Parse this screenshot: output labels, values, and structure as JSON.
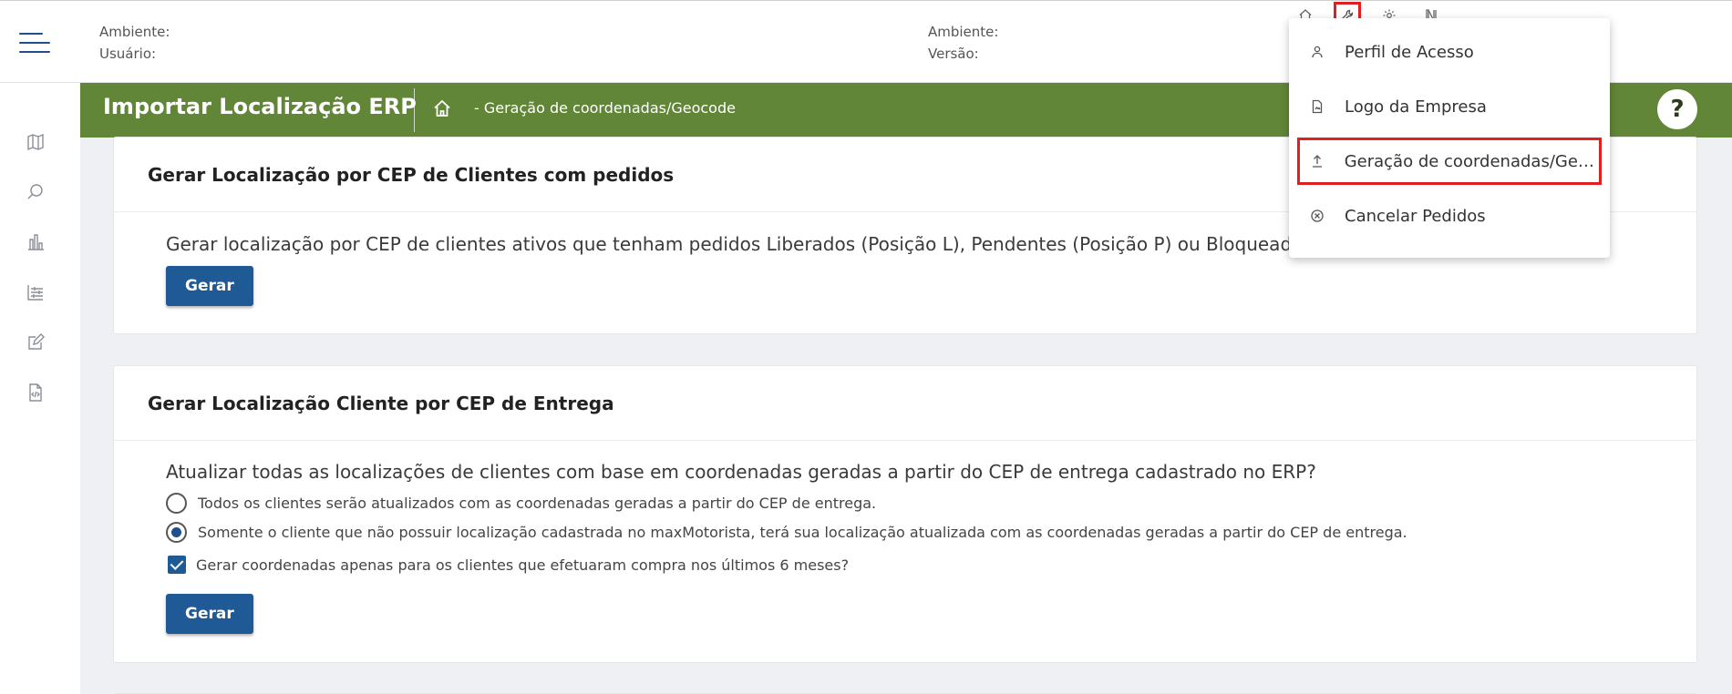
{
  "header": {
    "left": {
      "ambiente_label": "Ambiente:",
      "usuario_label": "Usuário:"
    },
    "right": {
      "ambiente_label": "Ambiente:",
      "versao_label": "Versão:"
    }
  },
  "top_icons": [
    "home-icon",
    "wrench-icon",
    "gear-icon",
    "map-book-icon"
  ],
  "rail_icons": [
    "map-icon",
    "search-icon",
    "bar-chart-icon",
    "sliders-icon",
    "edit-icon",
    "code-file-icon"
  ],
  "banner": {
    "title": "Importar Localização ERP",
    "breadcrumb": "- Geração de coordenadas/Geocode",
    "help": "?"
  },
  "menu": {
    "items": [
      {
        "label": "Perfil de Acesso",
        "icon": "user-icon"
      },
      {
        "label": "Logo da Empresa",
        "icon": "image-file-icon"
      },
      {
        "label": "Geração de coordenadas/Geo...",
        "icon": "upload-icon"
      },
      {
        "label": "Cancelar Pedidos",
        "icon": "cancel-circle-icon"
      }
    ]
  },
  "card1": {
    "title": "Gerar Localização por CEP de Clientes com pedidos",
    "question": "Gerar localização por CEP de clientes ativos que tenham pedidos Liberados (Posição L), Pendentes (Posição P) ou Bloqueados (Po",
    "button": "Gerar"
  },
  "card2": {
    "title": "Gerar Localização Cliente por CEP de Entrega",
    "question": "Atualizar todas as localizações de clientes com base em coordenadas geradas a partir do CEP de entrega cadastrado no ERP?",
    "option_all": "Todos os clientes serão atualizados com as coordenadas geradas a partir do CEP de entrega.",
    "option_missing": "Somente o cliente que não possuir localização cadastrada no maxMotorista, terá sua localização atualizada com as coordenadas geradas a partir do CEP de entrega.",
    "checkbox": "Gerar coordenadas apenas para os clientes que efetuaram compra nos últimos 6 meses?",
    "button": "Gerar"
  },
  "colors": {
    "banner": "#628637",
    "button": "#1f5a96",
    "highlight": "#e02020"
  }
}
